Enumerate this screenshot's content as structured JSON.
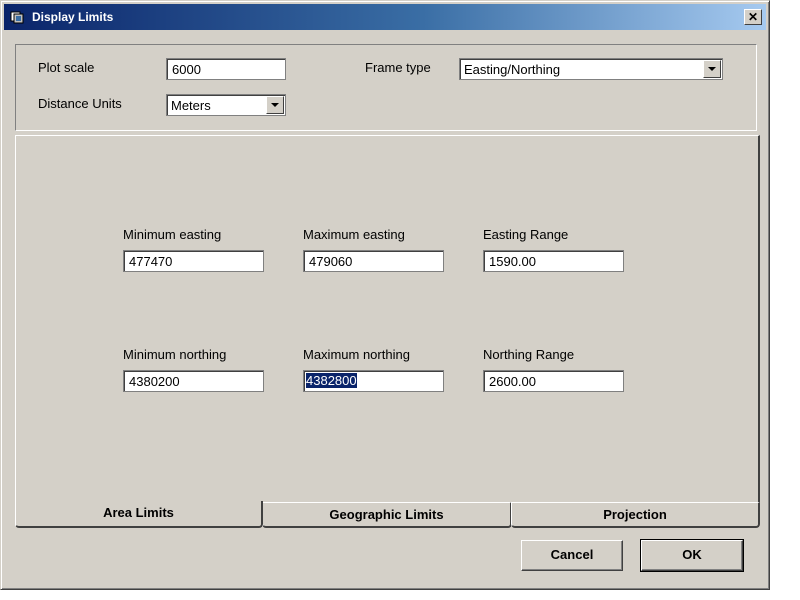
{
  "window": {
    "title": "Display Limits",
    "close_label": "✕"
  },
  "settings": {
    "plot_scale_label": "Plot scale",
    "plot_scale_value": "6000",
    "distance_units_label": "Distance Units",
    "distance_units_value": "Meters",
    "frame_type_label": "Frame type",
    "frame_type_value": "Easting/Northing"
  },
  "area_limits": {
    "min_easting_label": "Minimum easting",
    "min_easting_value": "477470",
    "max_easting_label": "Maximum easting",
    "max_easting_value": "479060",
    "easting_range_label": "Easting Range",
    "easting_range_value": "1590.00",
    "min_northing_label": "Minimum northing",
    "min_northing_value": "4380200",
    "max_northing_label": "Maximum northing",
    "max_northing_value": "4382800",
    "northing_range_label": "Northing Range",
    "northing_range_value": "2600.00"
  },
  "tabs": [
    {
      "label": "Area Limits",
      "active": true
    },
    {
      "label": "Geographic Limits",
      "active": false
    },
    {
      "label": "Projection",
      "active": false
    }
  ],
  "buttons": {
    "cancel": "Cancel",
    "ok": "OK"
  },
  "colors": {
    "face": "#d4d0c8",
    "title_start": "#0a246a",
    "title_end": "#a6caf0",
    "selection": "#0a246a"
  },
  "icons": {
    "app": "display-limits-app-icon",
    "close": "close-icon",
    "dropdown": "chevron-down-icon"
  }
}
